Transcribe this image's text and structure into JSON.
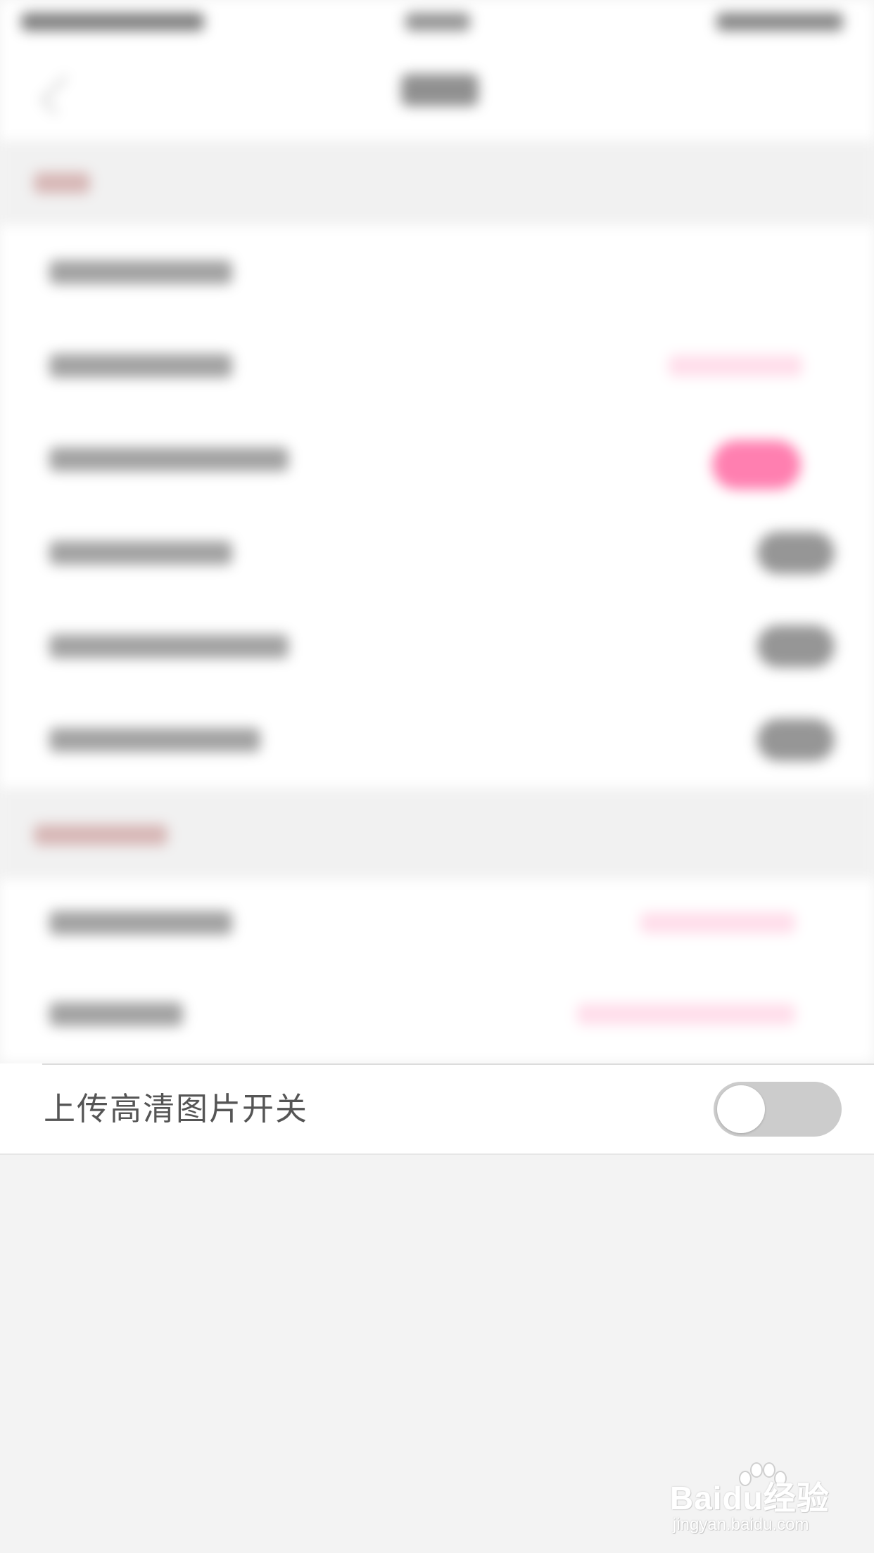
{
  "settings": {
    "hd_upload": {
      "label": "上传高清图片开关",
      "enabled": false,
      "track_color": "#cccccc",
      "knob_color": "#ffffff"
    }
  },
  "colors": {
    "accent_pink": "#ff7fb0",
    "background": "#f3f3f3",
    "row_background": "#ffffff",
    "label_text": "#555555"
  },
  "watermark": {
    "brand": "Baidu经验",
    "url": "jingyan.baidu.com",
    "icon": "paw-icon"
  }
}
